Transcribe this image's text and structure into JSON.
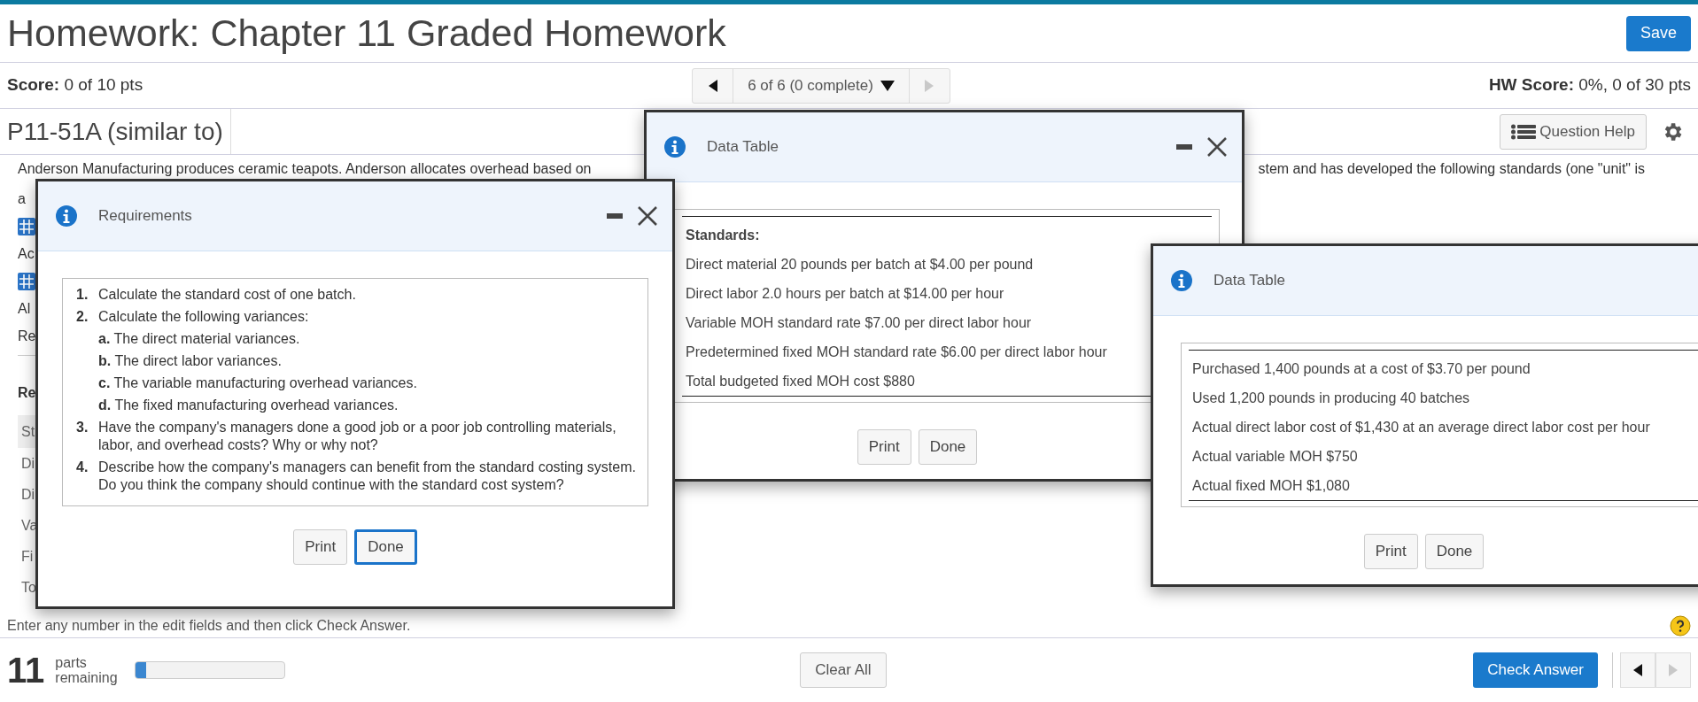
{
  "header": {
    "title": "Homework: Chapter 11 Graded Homework",
    "save_button": "Save"
  },
  "score_bar": {
    "score_label": "Score:",
    "score_value": "0 of 10 pts",
    "position": "6 of 6 (0 complete)",
    "prev_disabled": false,
    "next_disabled": true,
    "hw_score_label": "HW Score:",
    "hw_score_value": "0%, 0 of 30 pts"
  },
  "question": {
    "id": "P11-51A (similar to)",
    "help_button": "Question Help",
    "first_line": "Anderson Manufacturing produces ceramic teapots. Anderson allocates overhead based on",
    "first_line_right": "stem and has developed the following standards (one \"unit\" is",
    "fragments": [
      {
        "kind": "text",
        "text": "a"
      },
      {
        "kind": "icon"
      },
      {
        "kind": "text",
        "text": "Ac"
      },
      {
        "kind": "icon"
      },
      {
        "kind": "text",
        "text": "Al"
      },
      {
        "kind": "text",
        "text": "Re"
      },
      {
        "kind": "heading",
        "text": "Re"
      },
      {
        "kind": "header-row",
        "text": "St"
      },
      {
        "kind": "row",
        "text": "Di"
      },
      {
        "kind": "row",
        "text": "Di"
      },
      {
        "kind": "row",
        "text": "Va"
      },
      {
        "kind": "row",
        "text": "Fi"
      },
      {
        "kind": "row",
        "text": "To"
      }
    ]
  },
  "dialogs": [
    {
      "kind": "data",
      "title": "Data Table",
      "window_buttons": [
        {
          "kind": "minimize"
        },
        {
          "kind": "close"
        }
      ],
      "heading": "Standards:",
      "rows": [
        "Direct material 20 pounds per batch at $4.00 per pound",
        "Direct labor 2.0 hours per batch at $14.00 per hour",
        "Variable MOH standard rate $7.00 per direct labor hour",
        "Predetermined fixed MOH standard rate $6.00 per direct labor hour",
        "Total budgeted fixed MOH cost $880"
      ],
      "buttons": [
        {
          "label": "Print",
          "focused": false
        },
        {
          "label": "Done",
          "focused": false
        }
      ]
    },
    {
      "kind": "requirements",
      "title": "Requirements",
      "window_buttons": [
        {
          "kind": "minimize"
        },
        {
          "kind": "close"
        }
      ],
      "items": [
        {
          "number": "1.",
          "text": "Calculate the standard cost of one batch."
        },
        {
          "number": "2.",
          "text": "Calculate the following variances:",
          "children": [
            {
              "letter": "a.",
              "text": "The direct material variances."
            },
            {
              "letter": "b.",
              "text": "The direct labor variances."
            },
            {
              "letter": "c.",
              "text": "The variable manufacturing overhead variances."
            },
            {
              "letter": "d.",
              "text": "The fixed manufacturing overhead variances."
            }
          ]
        },
        {
          "number": "3.",
          "text": "Have the company's managers done a good job or a poor job controlling materials, labor, and overhead costs? Why or why not?"
        },
        {
          "number": "4.",
          "text": "Describe how the company's managers can benefit from the standard costing system. Do you think the company should continue with the standard cost system?"
        }
      ],
      "buttons": [
        {
          "label": "Print",
          "focused": false
        },
        {
          "label": "Done",
          "focused": true
        }
      ]
    },
    {
      "kind": "data",
      "title": "Data Table",
      "rows": [
        "Purchased 1,400 pounds at a cost of $3.70 per pound",
        "Used 1,200 pounds in producing 40 batches",
        "Actual direct labor cost of $1,430 at an average direct labor cost per hour",
        "Actual variable MOH $750",
        "Actual fixed MOH $1,080"
      ],
      "buttons": [
        {
          "label": "Print",
          "focused": false
        },
        {
          "label": "Done",
          "focused": false
        }
      ]
    }
  ],
  "footer": {
    "status": "Enter any number in the edit fields and then click Check Answer.",
    "parts_count": "11",
    "parts_label": "parts remaining",
    "level": 0.07,
    "clear_button": "Clear All",
    "check_button": "Check Answer",
    "prev_disabled": false,
    "next_disabled": true
  }
}
